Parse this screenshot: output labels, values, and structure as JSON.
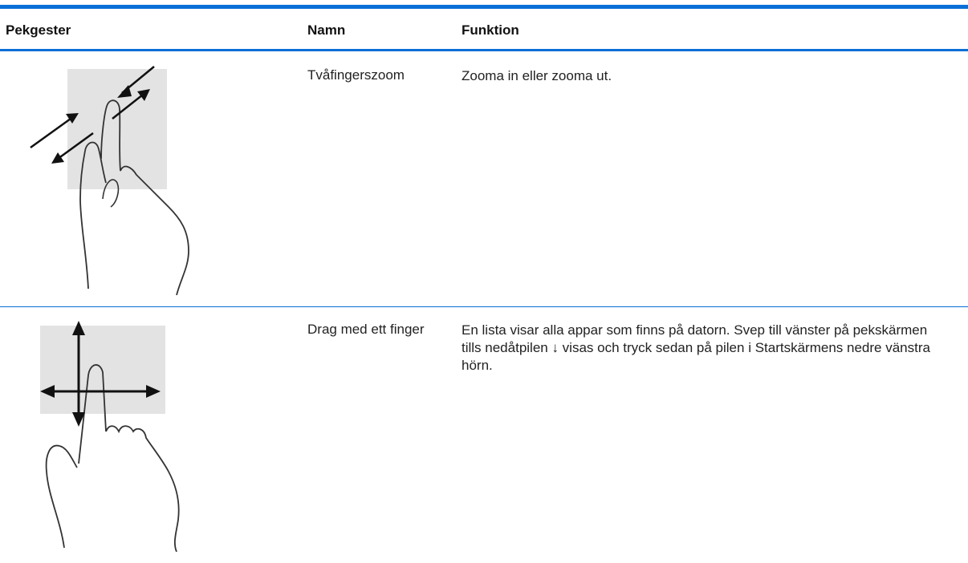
{
  "table": {
    "headers": {
      "gesture": "Pekgester",
      "name": "Namn",
      "function": "Funktion"
    },
    "rows": [
      {
        "gesture_icon": "two-finger-zoom-gesture-icon",
        "name": "Tvåfingerszoom",
        "function": "Zooma in eller zooma ut."
      },
      {
        "gesture_icon": "one-finger-drag-gesture-icon",
        "name": "Drag med ett finger",
        "function": "En lista visar alla appar som finns på datorn. Svep till vänster på pekskärmen tills nedåtpilen ↓ visas och tryck sedan på pilen i Startskärmens nedre vänstra hörn."
      }
    ]
  },
  "colors": {
    "rule": "#0a6fd6",
    "touch_area": "#e3e3e3"
  }
}
